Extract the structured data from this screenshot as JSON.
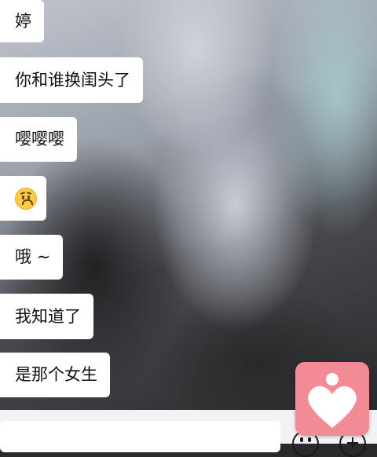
{
  "messages": [
    {
      "text": "婷"
    },
    {
      "text": "你和谁换闺头了"
    },
    {
      "text": "嘤嘤嘤"
    },
    {
      "emoji": "frowning-face-emoji"
    },
    {
      "text": "哦 ~"
    },
    {
      "text": "我知道了"
    },
    {
      "text": "是那个女生"
    }
  ],
  "icons": {
    "emoji_button": "smiley-icon",
    "more_button": "plus-icon",
    "floating_button": "heart-person-icon"
  },
  "colors": {
    "bubble": "#ffffff",
    "input_bar": "#f2f2f4",
    "heart_button": "#f28b96"
  }
}
